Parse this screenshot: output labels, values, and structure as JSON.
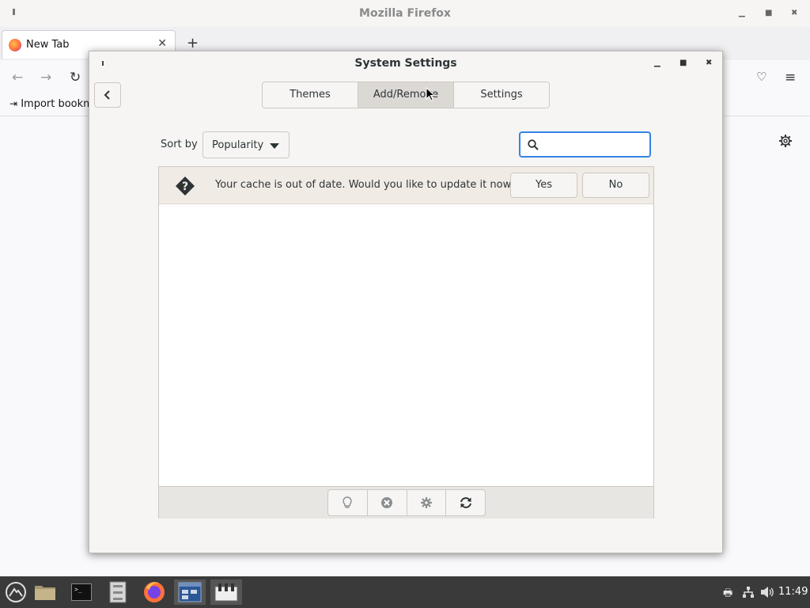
{
  "firefox": {
    "window_title": "Mozilla Firefox",
    "tab_title": "New Tab",
    "bookmark_label": "Import bookm"
  },
  "dialog": {
    "title": "System Settings",
    "tabs": [
      {
        "label": "Themes"
      },
      {
        "label": "Add/Remove",
        "active": true
      },
      {
        "label": "Settings"
      }
    ],
    "sort_label": "Sort by",
    "sort_value": "Popularity",
    "search": {
      "value": "",
      "placeholder": ""
    },
    "infobar": {
      "message": "Your cache is out of date. Would you like to update it now?",
      "yes_label": "Yes",
      "no_label": "No"
    },
    "toolbar_icons": [
      "lightbulb-icon",
      "remove-icon",
      "gear-icon",
      "refresh-icon"
    ]
  },
  "taskbar": {
    "apps": [
      "menu-icon",
      "folder-icon",
      "terminal-icon",
      "file-cabinet-icon",
      "firefox-icon",
      "window-icon",
      "settings-app-icon"
    ],
    "clock": "11:49"
  },
  "colors": {
    "accent": "#3584e4",
    "infobar_bg": "#f1ebe6",
    "taskbar_bg": "#3a3a3a"
  }
}
